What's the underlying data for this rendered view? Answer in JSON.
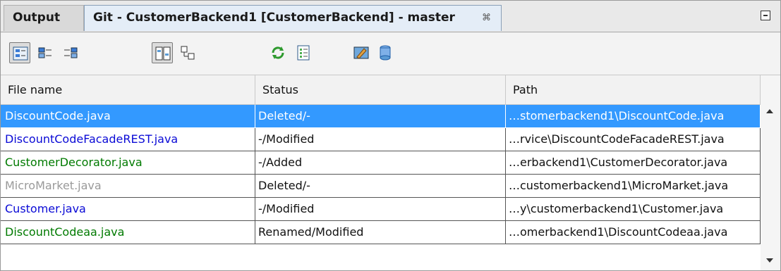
{
  "tabs": [
    {
      "label": "Output",
      "active": false
    },
    {
      "label": "Git - CustomerBackend1 [CustomerBackend] - master",
      "active": true,
      "close_glyph": "⌘"
    }
  ],
  "toolbar": {
    "icons": [
      "show-all-changes-icon",
      "show-local-changes-icon",
      "show-remote-changes-icon",
      "diff-all-icon",
      "open-in-editor-icon",
      "refresh-status-icon",
      "show-history-icon",
      "commit-icon",
      "stash-icon"
    ]
  },
  "table": {
    "columns": [
      "File name",
      "Status",
      "Path"
    ],
    "rows": [
      {
        "name": "DiscountCode.java",
        "status": "Deleted/-",
        "path": "…stomerbackend1\\DiscountCode.java",
        "color": "#ffffff",
        "selected": true
      },
      {
        "name": "DiscountCodeFacadeREST.java",
        "status": "-/Modified",
        "path": "…rvice\\DiscountCodeFacadeREST.java",
        "color": "#0a0ad6",
        "selected": false
      },
      {
        "name": "CustomerDecorator.java",
        "status": "-/Added",
        "path": "…erbackend1\\CustomerDecorator.java",
        "color": "#007a00",
        "selected": false
      },
      {
        "name": "MicroMarket.java",
        "status": "Deleted/-",
        "path": "…customerbackend1\\MicroMarket.java",
        "color": "#9a9a9a",
        "selected": false
      },
      {
        "name": "Customer.java",
        "status": "-/Modified",
        "path": "…y\\customerbackend1\\Customer.java",
        "color": "#0a0ad6",
        "selected": false
      },
      {
        "name": "DiscountCodeaa.java",
        "status": "Renamed/Modified",
        "path": "…omerbackend1\\DiscountCodeaa.java",
        "color": "#007a00",
        "selected": false
      }
    ]
  },
  "colors": {
    "selection": "#3399ff",
    "modified": "#0a0ad6",
    "added": "#007a00",
    "deleted": "#9a9a9a"
  }
}
